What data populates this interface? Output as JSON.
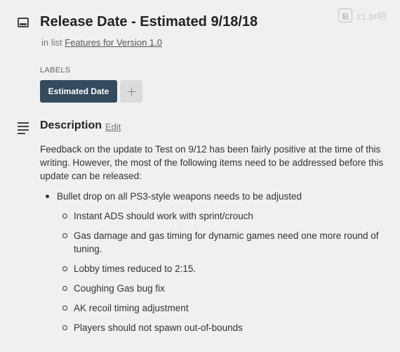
{
  "card": {
    "title": "Release Date - Estimated 9/18/18",
    "in_list_prefix": "in list",
    "list_name": "Features for Version 1.0"
  },
  "watermark": {
    "logo": "贴",
    "text": "z1.br吧"
  },
  "labels": {
    "heading": "LABELS",
    "items": [
      "Estimated Date"
    ],
    "add_label": "+"
  },
  "description": {
    "heading": "Description",
    "edit_label": "Edit",
    "body": "Feedback on the update to Test on 9/12 has been fairly positive at the time of this writing. However, the most of the following items need to be addressed before this update can be released:",
    "items": [
      {
        "text": "Bullet drop on all PS3-style weapons needs to be adjusted",
        "subitems": [
          "Instant ADS should work with sprint/crouch",
          "Gas damage and gas timing for dynamic games need one more round of tuning.",
          "Lobby times reduced to 2:15.",
          "Coughing Gas bug fix",
          "AK recoil timing adjustment",
          "Players should not spawn out-of-bounds"
        ]
      }
    ]
  },
  "icons": {
    "card": "card-icon",
    "description": "description-lines-icon",
    "add": "plus-icon"
  }
}
